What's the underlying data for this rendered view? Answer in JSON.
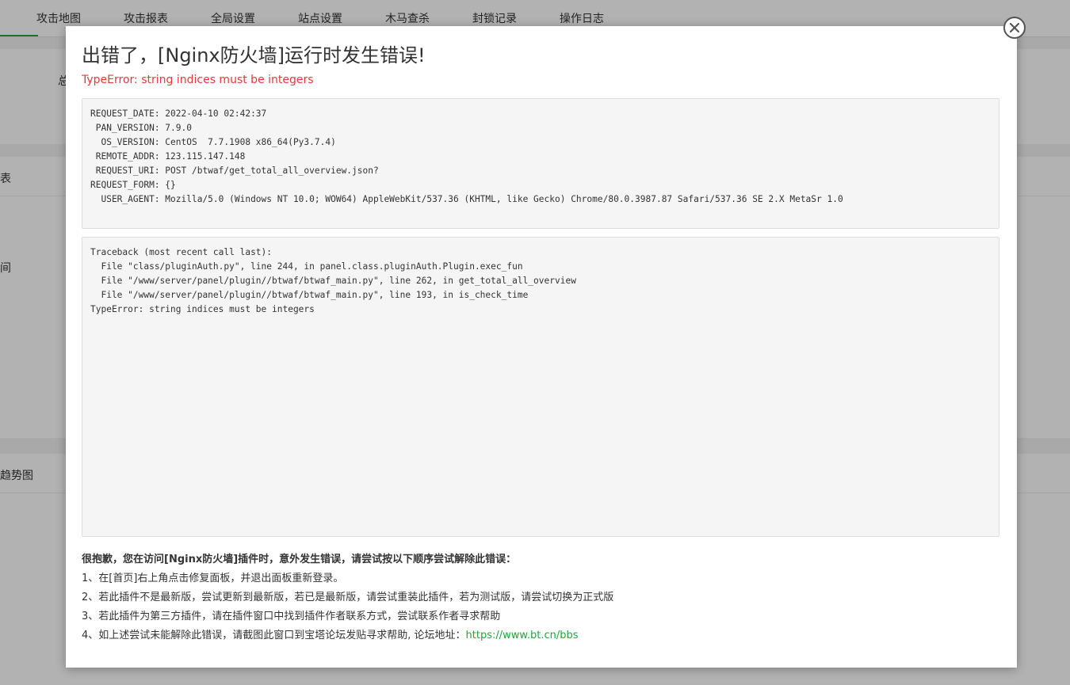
{
  "background": {
    "tabs": [
      "攻击地图",
      "攻击报表",
      "全局设置",
      "站点设置",
      "木马查杀",
      "封锁记录",
      "操作日志"
    ],
    "fragments": [
      "总",
      "表",
      "间",
      "趋势图"
    ]
  },
  "modal": {
    "title": "出错了，[Nginx防火墙]运行时发生错误!",
    "error_message": "TypeError: string indices must be integers",
    "request_info": "REQUEST_DATE: 2022-04-10 02:42:37\n PAN_VERSION: 7.9.0\n  OS_VERSION: CentOS  7.7.1908 x86_64(Py3.7.4)\n REMOTE_ADDR: 123.115.147.148\n REQUEST_URI: POST /btwaf/get_total_all_overview.json?\nREQUEST_FORM: {}\n  USER_AGENT: Mozilla/5.0 (Windows NT 10.0; WOW64) AppleWebKit/537.36 (KHTML, like Gecko) Chrome/80.0.3987.87 Safari/537.36 SE 2.X MetaSr 1.0",
    "traceback": "Traceback (most recent call last):\n  File \"class/pluginAuth.py\", line 244, in panel.class.pluginAuth.Plugin.exec_fun\n  File \"/www/server/panel/plugin//btwaf/btwaf_main.py\", line 262, in get_total_all_overview\n  File \"/www/server/panel/plugin//btwaf/btwaf_main.py\", line 193, in is_check_time\nTypeError: string indices must be integers",
    "help_title": "很抱歉，您在访问[Nginx防火墙]插件时，意外发生错误，请尝试按以下顺序尝试解除此错误：",
    "help_steps": [
      "1、在[首页]右上角点击修复面板，并退出面板重新登录。",
      "2、若此插件不是最新版，尝试更新到最新版，若已是最新版，请尝试重装此插件，若为测试版，请尝试切换为正式版",
      "3、若此插件为第三方插件，请在插件窗口中找到插件作者联系方式，尝试联系作者寻求帮助"
    ],
    "help_step4_prefix": "4、如上述尝试未能解除此错误，请截图此窗口到宝塔论坛发贴寻求帮助, 论坛地址：",
    "forum_link": "https://www.bt.cn/bbs",
    "close_icon": "close-icon"
  }
}
